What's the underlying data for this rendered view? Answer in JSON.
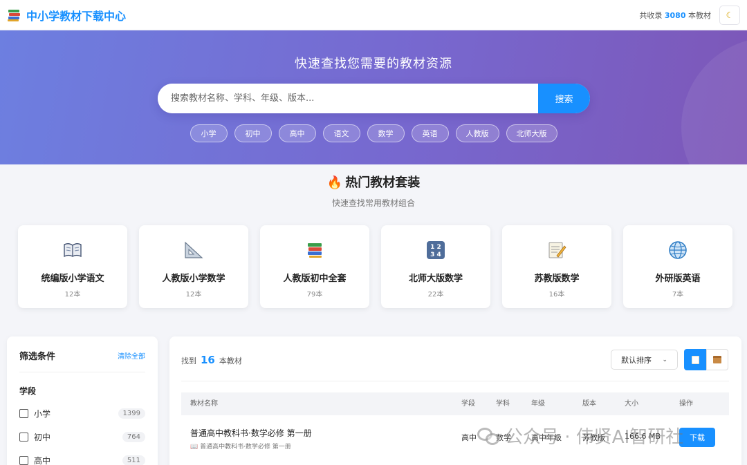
{
  "header": {
    "title": "中小学教材下载中心",
    "count_prefix": "共收录",
    "count_value": "3080",
    "count_suffix": "本教材",
    "theme_icon": "moon-icon"
  },
  "hero": {
    "title": "快速查找您需要的教材资源",
    "search_placeholder": "搜索教材名称、学科、年级、版本...",
    "search_button": "搜索",
    "tags": [
      "小学",
      "初中",
      "高中",
      "语文",
      "数学",
      "英语",
      "人教版",
      "北师大版"
    ]
  },
  "hot": {
    "title": "热门教材套装",
    "subtitle": "快速查找常用教材组合",
    "cards": [
      {
        "name": "统编版小学语文",
        "count": "12本",
        "icon": "open-book-icon"
      },
      {
        "name": "人教版小学数学",
        "count": "12本",
        "icon": "triangle-ruler-icon"
      },
      {
        "name": "人教版初中全套",
        "count": "79本",
        "icon": "books-icon"
      },
      {
        "name": "北师大版数学",
        "count": "22本",
        "icon": "numbers-icon"
      },
      {
        "name": "苏教版数学",
        "count": "16本",
        "icon": "memo-icon"
      },
      {
        "name": "外研版英语",
        "count": "7本",
        "icon": "globe-icon"
      }
    ]
  },
  "filter": {
    "title": "筛选条件",
    "clear": "清除全部",
    "group_title": "学段",
    "options": [
      {
        "label": "小学",
        "count": "1399"
      },
      {
        "label": "初中",
        "count": "764"
      },
      {
        "label": "高中",
        "count": "511"
      }
    ]
  },
  "results": {
    "found_prefix": "找到",
    "found_count": "16",
    "found_suffix": "本教材",
    "sort_value": "默认排序",
    "columns": [
      "教材名称",
      "学段",
      "学科",
      "年级",
      "版本",
      "大小",
      "操作"
    ],
    "rows": [
      {
        "name": "普通高中教科书·数学必修 第一册",
        "sub": "📖 普通高中教科书·数学必修 第一册",
        "stage": "高中",
        "subject": "数学",
        "grade": "高中年级",
        "edition": "苏教版",
        "size": "166.6 MB",
        "action": "下载"
      }
    ]
  },
  "watermark": {
    "text": "公众号 · 伟贤AI智研社"
  }
}
